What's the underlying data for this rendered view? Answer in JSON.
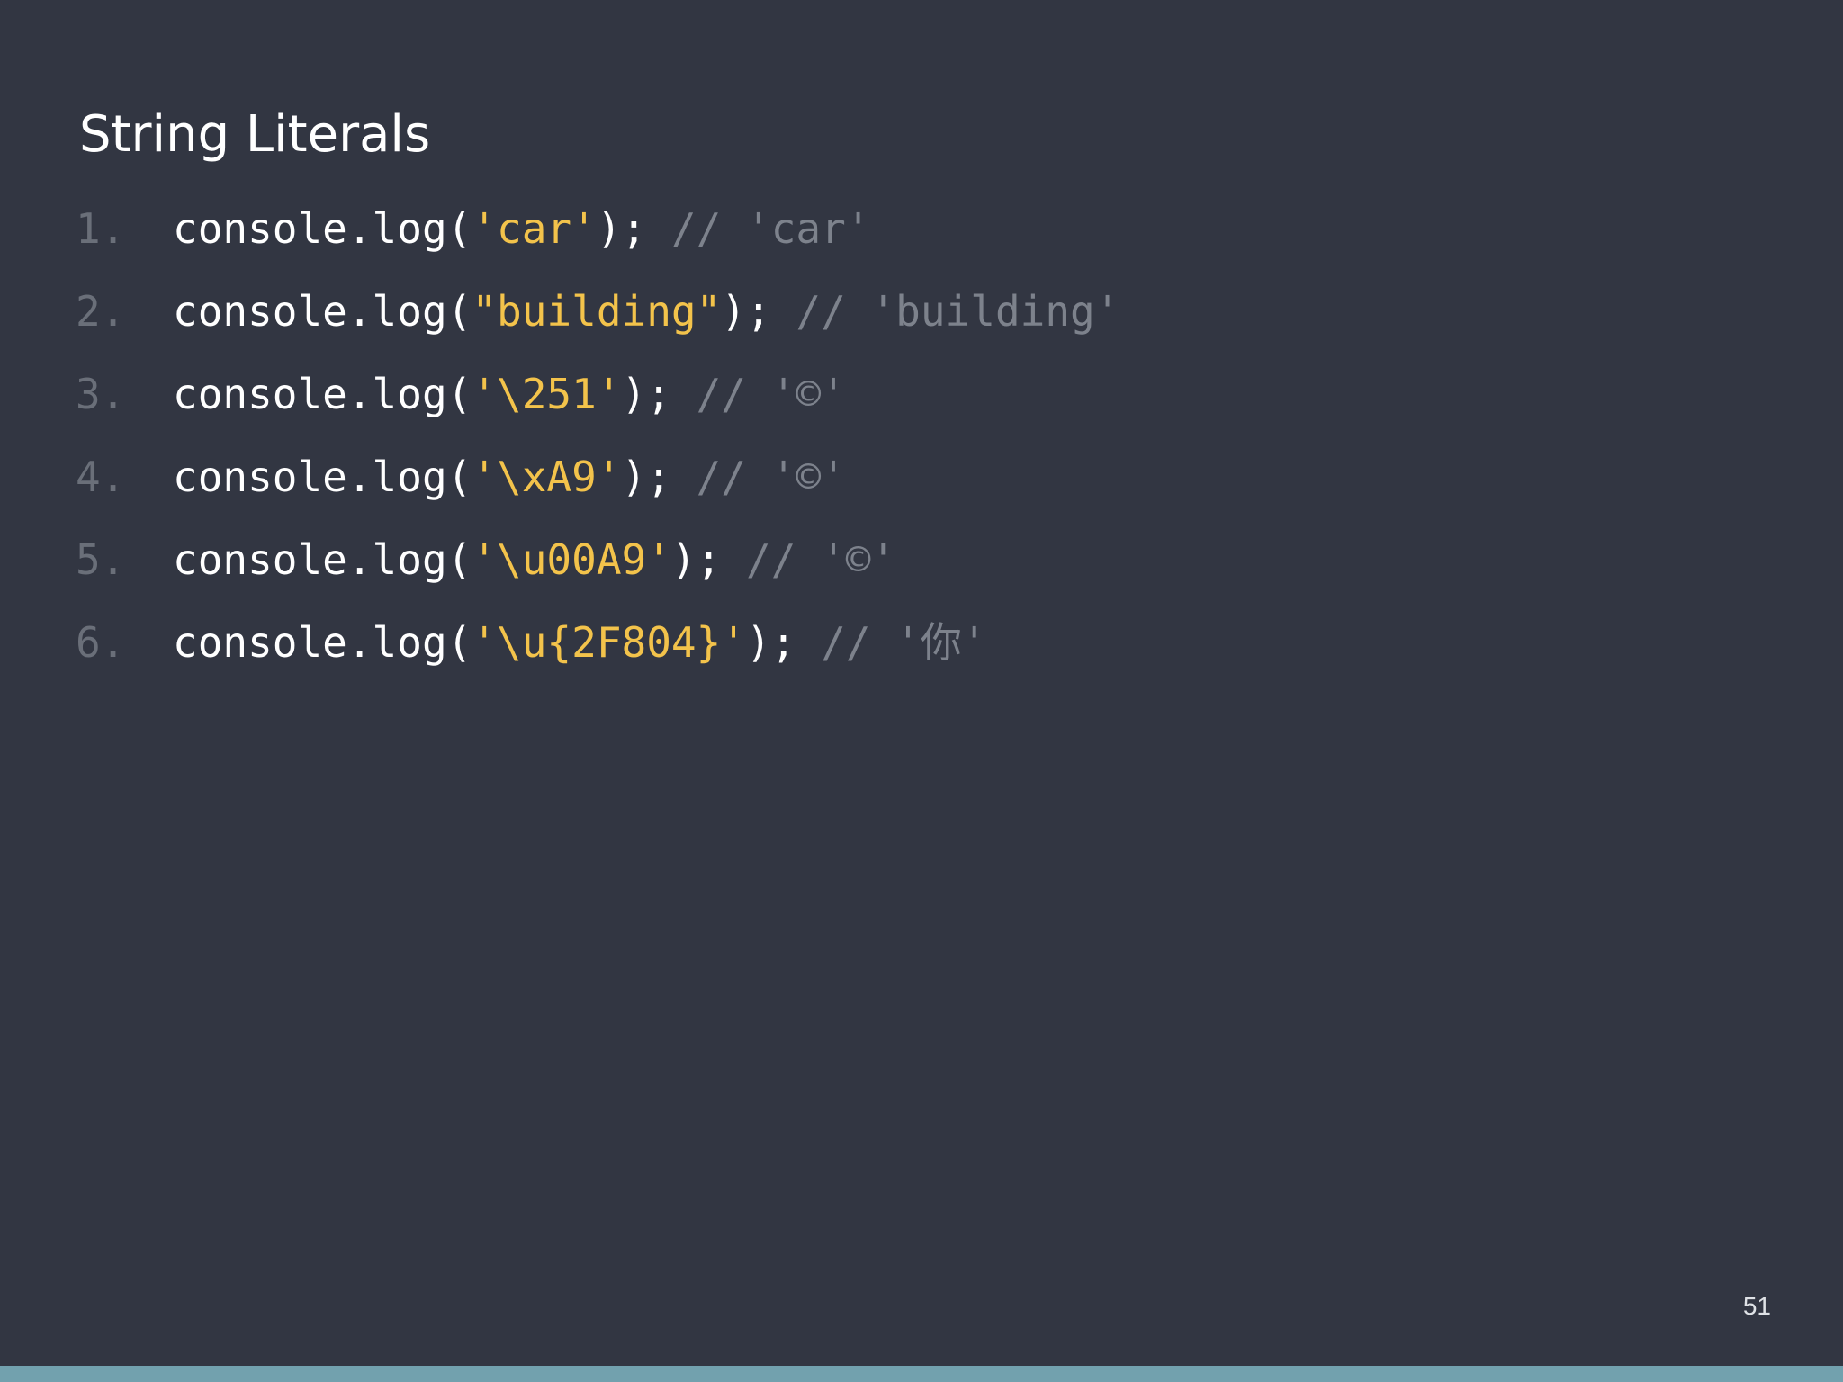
{
  "slide": {
    "title": "String Literals",
    "page_number": "51"
  },
  "colors": {
    "background": "#323642",
    "code_text": "#ffffff",
    "string_literal": "#f3c34b",
    "comment": "#7d828c",
    "line_number": "#6a6f79",
    "bottom_bar": "#72a1ae"
  },
  "code_lines": [
    {
      "number": "1.",
      "prefix": "console.log(",
      "string": "'car'",
      "suffix": ");",
      "comment": "// 'car'"
    },
    {
      "number": "2.",
      "prefix": "console.log(",
      "string": "\"building\"",
      "suffix": ");",
      "comment": "// 'building'"
    },
    {
      "number": "3.",
      "prefix": "console.log(",
      "string": "'\\251'",
      "suffix": ");",
      "comment": "// '©'"
    },
    {
      "number": "4.",
      "prefix": "console.log(",
      "string": "'\\xA9'",
      "suffix": ");",
      "comment": "// '©'"
    },
    {
      "number": "5.",
      "prefix": "console.log(",
      "string": "'\\u00A9'",
      "suffix": ");",
      "comment": "// '©'"
    },
    {
      "number": "6.",
      "prefix": "console.log(",
      "string": "'\\u{2F804}'",
      "suffix": ");",
      "comment": "// '你'"
    }
  ]
}
